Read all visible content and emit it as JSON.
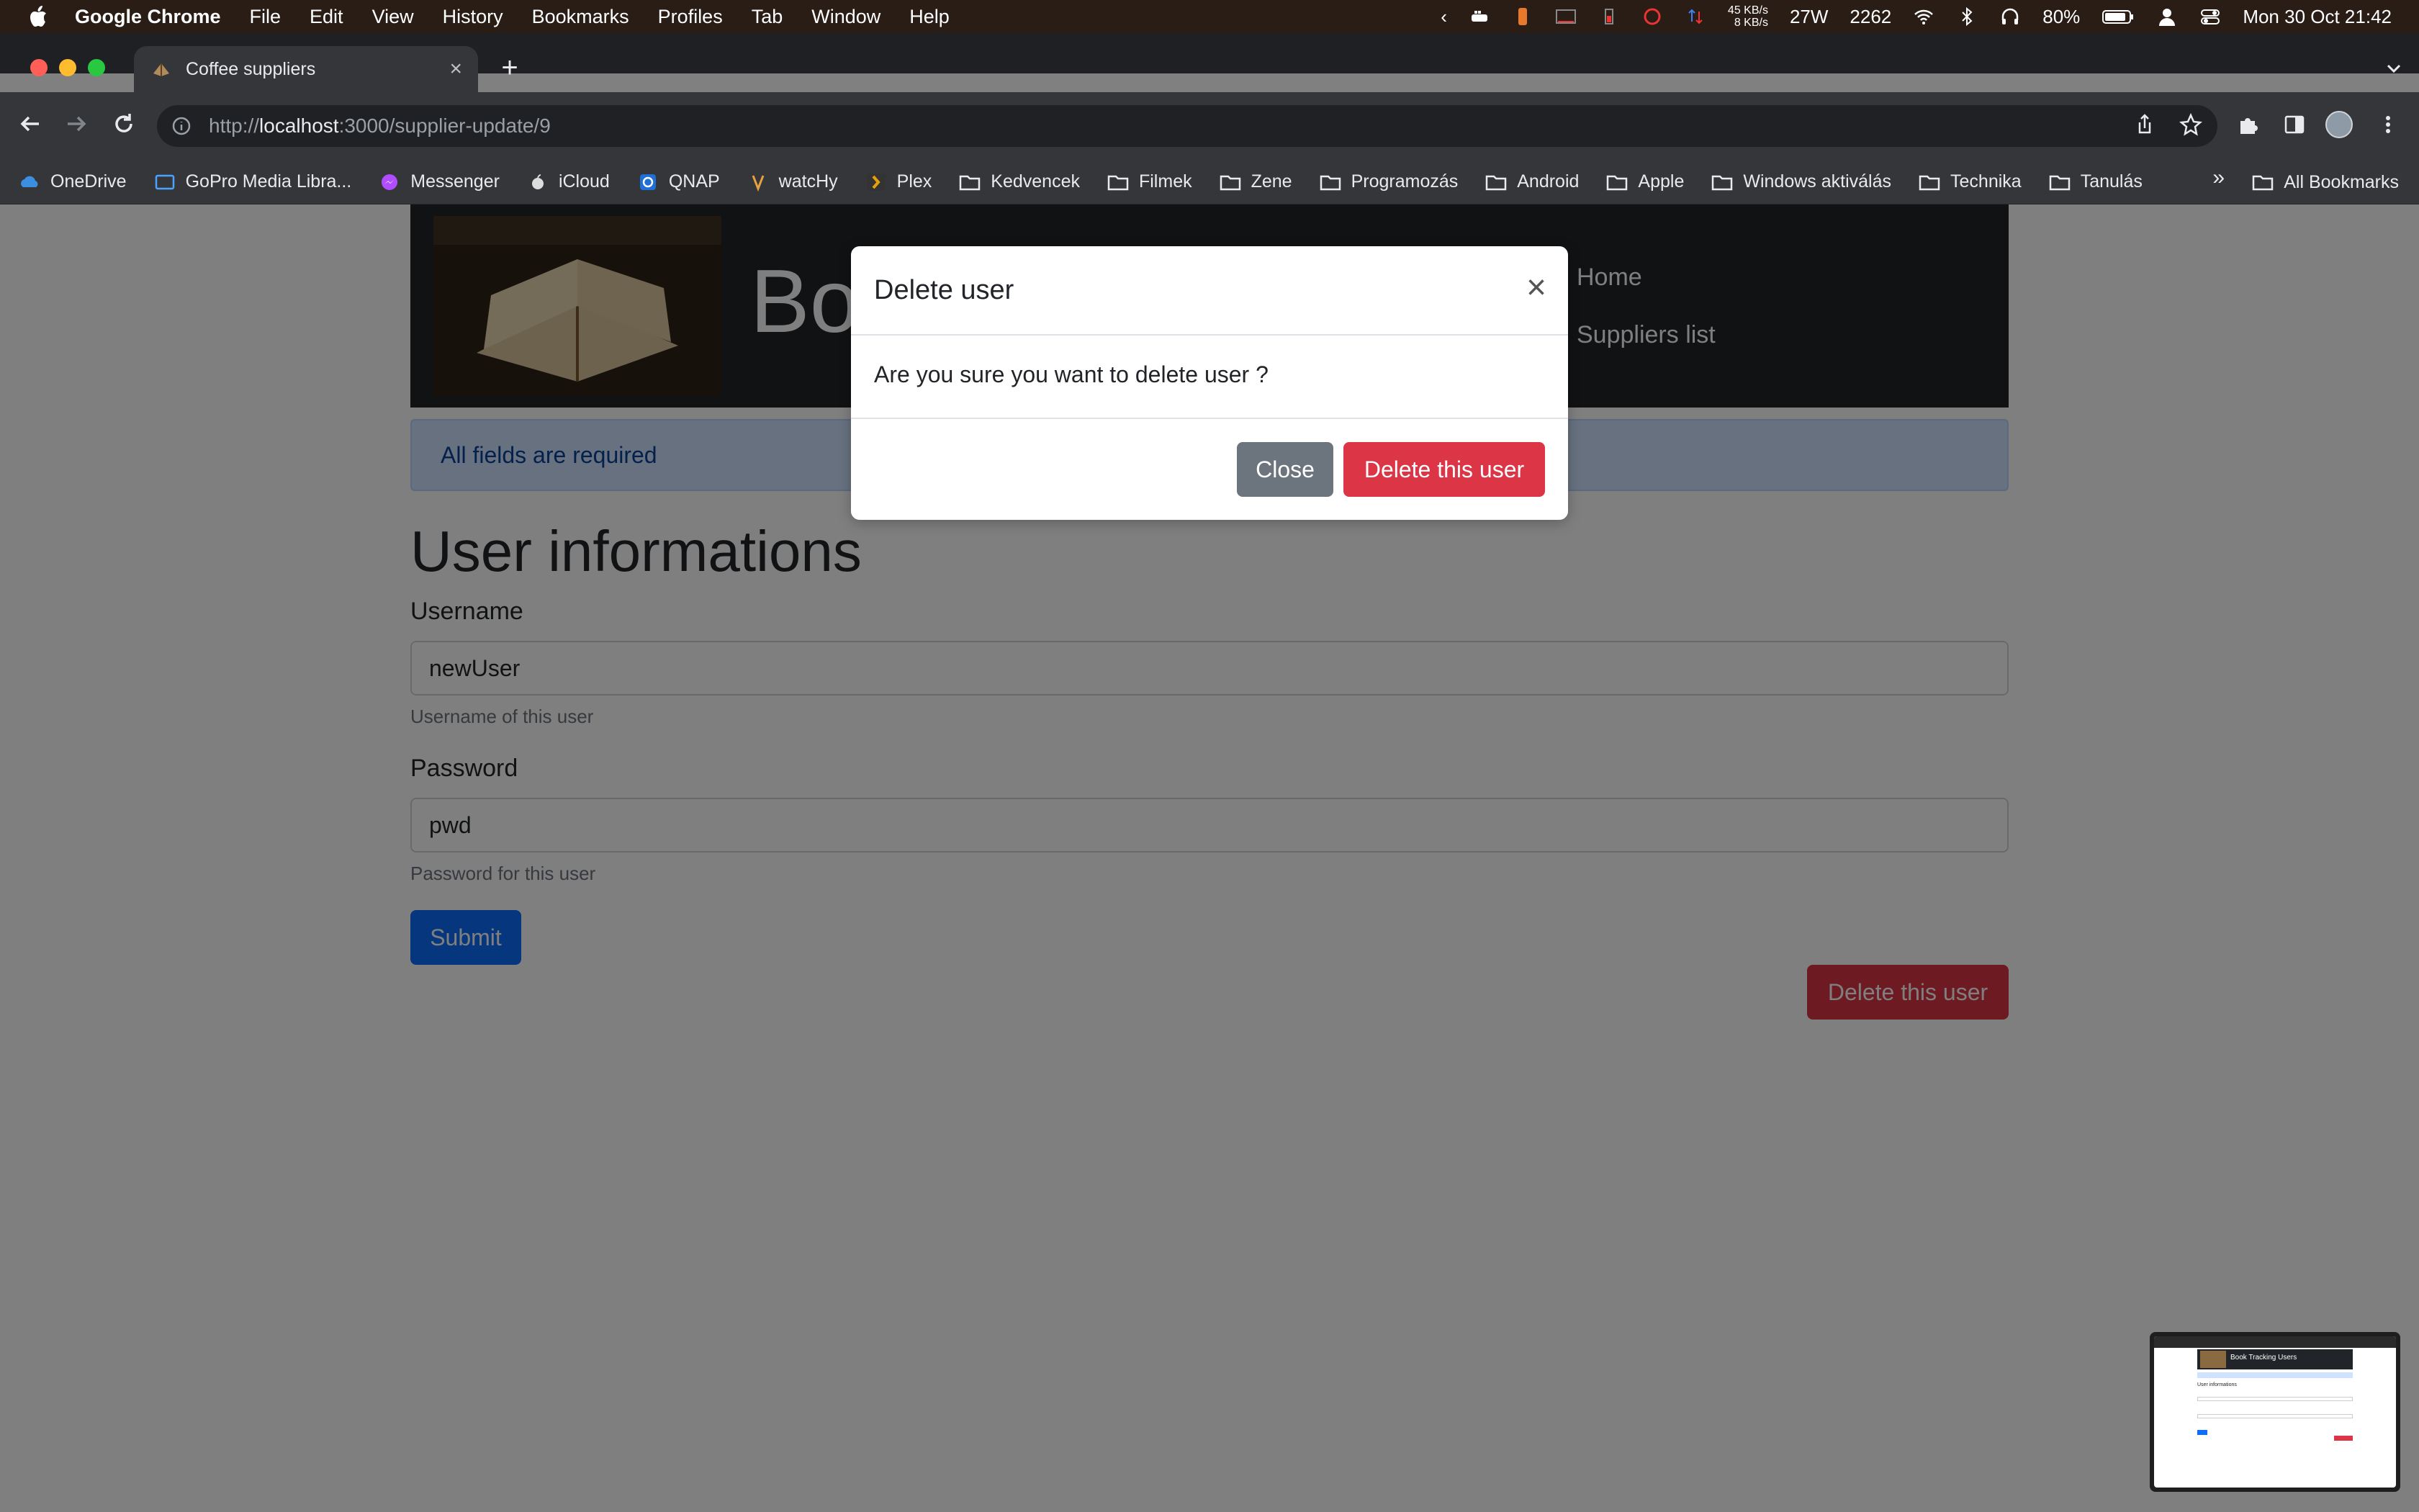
{
  "menubar": {
    "app_name": "Google Chrome",
    "items": [
      "File",
      "Edit",
      "View",
      "History",
      "Bookmarks",
      "Profiles",
      "Tab",
      "Window",
      "Help"
    ],
    "status": {
      "net_up": "45 KB/s",
      "net_down": "8 KB/s",
      "power": "27W",
      "fan": "2262",
      "battery": "80%",
      "datetime": "Mon 30 Oct  21:42"
    }
  },
  "browser": {
    "tab_title": "Coffee suppliers",
    "url_prefix": "http://",
    "url_host": "localhost",
    "url_path": ":3000/supplier-update/9",
    "bookmarks": [
      "OneDrive",
      "GoPro Media Libra...",
      "Messenger",
      "iCloud",
      "QNAP",
      "watcHy",
      "Plex",
      "Kedvencek",
      "Filmek",
      "Zene",
      "Programozás",
      "Android",
      "Apple",
      "Windows aktiválás",
      "Technika",
      "Tanulás"
    ],
    "bookmarks_more": "»",
    "all_bookmarks": "All Bookmarks"
  },
  "site": {
    "title_visible": "Bo",
    "nav": {
      "home": "Home",
      "suppliers": "Suppliers list"
    },
    "alert": "All fields are required",
    "page_title": "User informations",
    "form": {
      "username_label": "Username",
      "username_value": "newUser",
      "username_help": "Username of this user",
      "password_label": "Password",
      "password_value": "pwd",
      "password_help": "Password for this user",
      "submit_label": "Submit",
      "delete_label": "Delete this user"
    }
  },
  "modal": {
    "title": "Delete user",
    "close_x": "×",
    "body": "Are you sure you want to delete user ?",
    "close_label": "Close",
    "delete_label": "Delete this user"
  },
  "thumbnail": {
    "title": "Book Tracking Users",
    "heading": "User informations"
  },
  "colors": {
    "primary": "#0d6efd",
    "danger": "#dc3545",
    "secondary": "#6c757d",
    "alert_bg": "#cfe2ff",
    "header_bg": "#212529"
  }
}
